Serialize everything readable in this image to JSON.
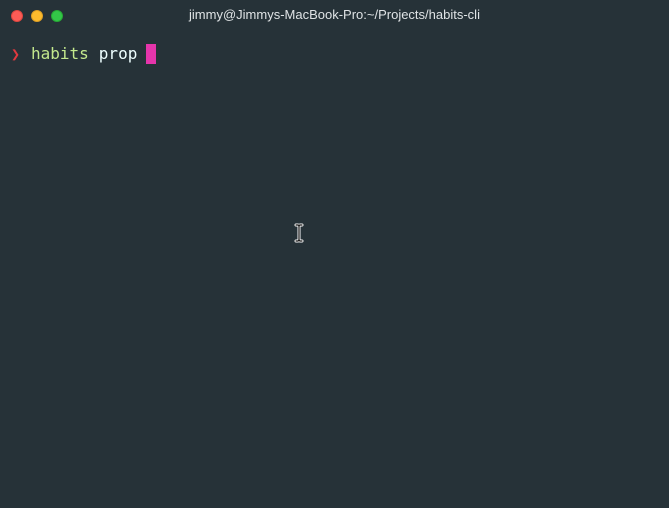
{
  "window": {
    "title": "jimmy@Jimmys-MacBook-Pro:~/Projects/habits-cli",
    "colors": {
      "background": "#263238",
      "close": "#fc5c56",
      "minimize": "#fdbb2d",
      "zoom": "#33c748"
    }
  },
  "terminal": {
    "prompt_symbol": "❯",
    "command": "habits",
    "argument": "prop",
    "colors": {
      "prompt": "#e0393f",
      "command": "#c3e88d",
      "argument": "#eeffff",
      "cursor": "#e535ab"
    }
  },
  "pointer": {
    "icon": "text-ibeam-cursor-icon"
  }
}
